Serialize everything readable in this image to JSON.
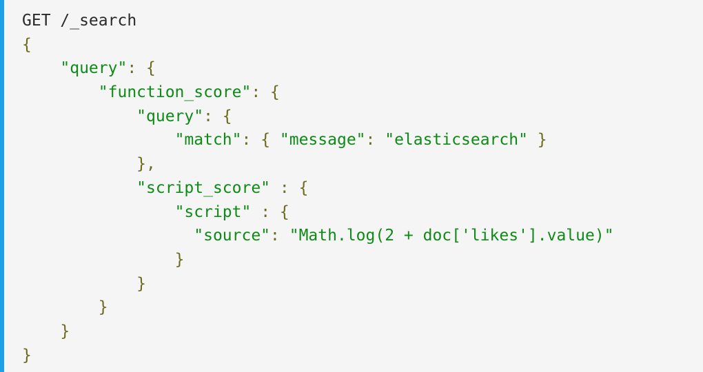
{
  "colors": {
    "background": "#f5f5f5",
    "accent_border": "#1ea0e6",
    "default_text": "#2a2a2a",
    "punctuation": "#6b6a1f",
    "string": "#0e8a16"
  },
  "code": {
    "lines": [
      [
        {
          "t": "GET /_search",
          "c": "default"
        }
      ],
      [
        {
          "t": "{",
          "c": "punct"
        }
      ],
      [
        {
          "t": "    ",
          "c": "default"
        },
        {
          "t": "\"query\"",
          "c": "string"
        },
        {
          "t": ": {",
          "c": "punct"
        }
      ],
      [
        {
          "t": "        ",
          "c": "default"
        },
        {
          "t": "\"function_score\"",
          "c": "string"
        },
        {
          "t": ": {",
          "c": "punct"
        }
      ],
      [
        {
          "t": "            ",
          "c": "default"
        },
        {
          "t": "\"query\"",
          "c": "string"
        },
        {
          "t": ": {",
          "c": "punct"
        }
      ],
      [
        {
          "t": "                ",
          "c": "default"
        },
        {
          "t": "\"match\"",
          "c": "string"
        },
        {
          "t": ": { ",
          "c": "punct"
        },
        {
          "t": "\"message\"",
          "c": "string"
        },
        {
          "t": ": ",
          "c": "punct"
        },
        {
          "t": "\"elasticsearch\"",
          "c": "string"
        },
        {
          "t": " }",
          "c": "punct"
        }
      ],
      [
        {
          "t": "            ",
          "c": "default"
        },
        {
          "t": "},",
          "c": "punct"
        }
      ],
      [
        {
          "t": "            ",
          "c": "default"
        },
        {
          "t": "\"script_score\"",
          "c": "string"
        },
        {
          "t": " : {",
          "c": "punct"
        }
      ],
      [
        {
          "t": "                ",
          "c": "default"
        },
        {
          "t": "\"script\"",
          "c": "string"
        },
        {
          "t": " : {",
          "c": "punct"
        }
      ],
      [
        {
          "t": "                  ",
          "c": "default"
        },
        {
          "t": "\"source\"",
          "c": "string"
        },
        {
          "t": ": ",
          "c": "punct"
        },
        {
          "t": "\"Math.log(2 + doc['likes'].value)\"",
          "c": "string"
        }
      ],
      [
        {
          "t": "                ",
          "c": "default"
        },
        {
          "t": "}",
          "c": "punct"
        }
      ],
      [
        {
          "t": "            ",
          "c": "default"
        },
        {
          "t": "}",
          "c": "punct"
        }
      ],
      [
        {
          "t": "        ",
          "c": "default"
        },
        {
          "t": "}",
          "c": "punct"
        }
      ],
      [
        {
          "t": "    ",
          "c": "default"
        },
        {
          "t": "}",
          "c": "punct"
        }
      ],
      [
        {
          "t": "}",
          "c": "punct"
        }
      ]
    ]
  }
}
